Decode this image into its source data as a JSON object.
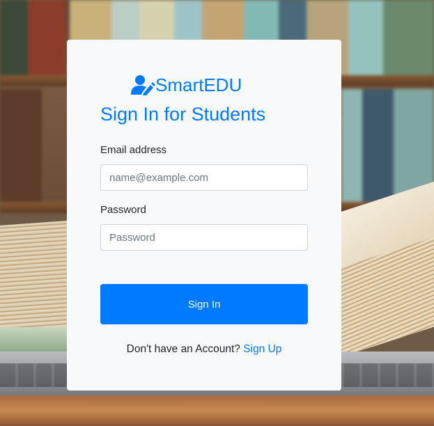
{
  "brand": {
    "name": "SmartEDU",
    "icon": "user-edit-icon",
    "color": "#007bff"
  },
  "form": {
    "title": "Sign In for Students",
    "email_label": "Email address",
    "email_placeholder": "name@example.com",
    "email_value": "",
    "password_label": "Password",
    "password_placeholder": "Password",
    "password_value": "",
    "submit_label": "Sign In"
  },
  "footer": {
    "prompt": "Don't have an Account?",
    "link_label": "Sign Up"
  },
  "colors": {
    "primary": "#007bff",
    "card_bg": "#f8f9fa",
    "text": "#212529"
  }
}
